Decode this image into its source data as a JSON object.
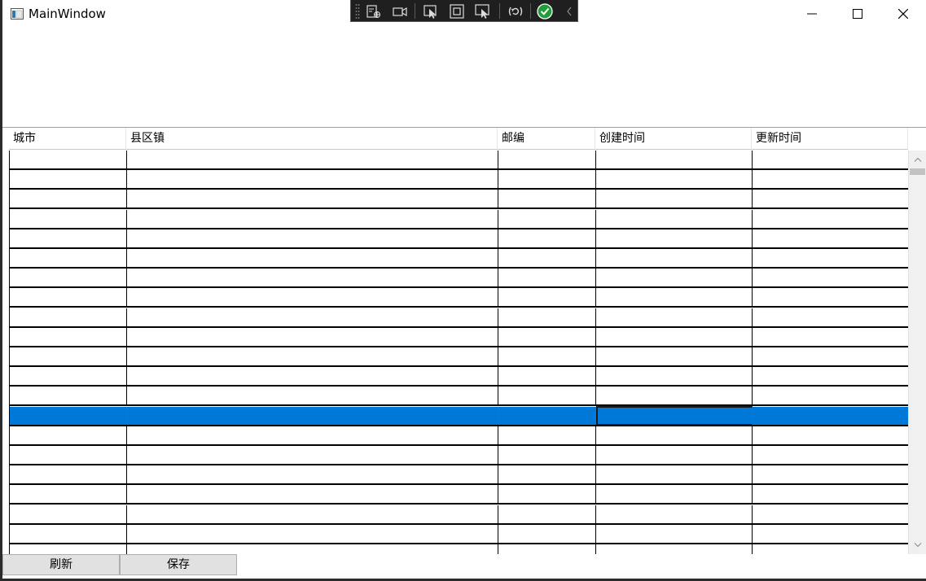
{
  "window": {
    "title": "MainWindow"
  },
  "grid": {
    "columns": [
      {
        "label": "城市"
      },
      {
        "label": "县区镇"
      },
      {
        "label": "邮编"
      },
      {
        "label": "创建时间"
      },
      {
        "label": "更新时间"
      }
    ],
    "visible_row_count": 21,
    "selected_row_index": 13,
    "selected_color": "#0078d7"
  },
  "buttons": {
    "refresh_label": "刷新",
    "save_label": "保存"
  },
  "devbar": {
    "tools": [
      "select-element-icon",
      "record-icon",
      "pointer-select-icon",
      "layout-bounds-icon",
      "display-highlight-icon",
      "hot-reload-icon",
      "check-status-icon",
      "collapse-chevron-icon"
    ]
  }
}
